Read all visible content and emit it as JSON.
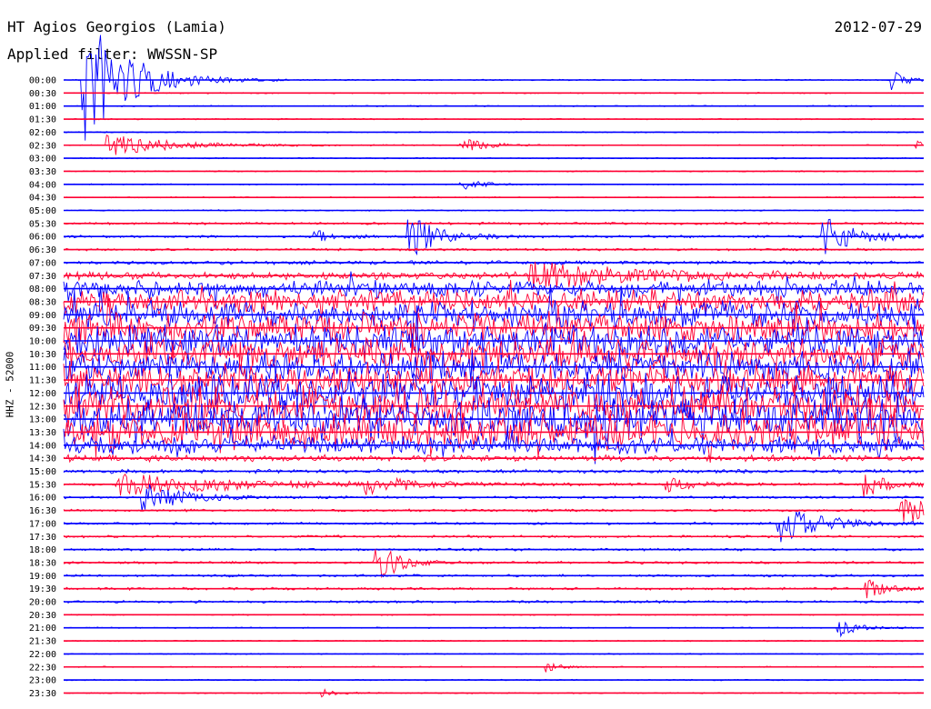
{
  "header": {
    "station": "HT Agios Georgios (Lamia)",
    "date": "2012-07-29",
    "filter": "Applied filter: WWSSN-SP",
    "channel": "HHZ - 52000"
  },
  "colors": {
    "even_rows": "#0000ff",
    "odd_rows": "#ff0033",
    "background": "#ffffff",
    "text": "#000000"
  },
  "chart_data": {
    "type": "line",
    "title": "HT Agios Georgios (Lamia)",
    "xlabel": "",
    "ylabel": "HHZ - 52000",
    "categories": [
      "00:00",
      "00:30",
      "01:00",
      "01:30",
      "02:00",
      "02:30",
      "03:00",
      "03:30",
      "04:00",
      "04:30",
      "05:00",
      "05:30",
      "06:00",
      "06:30",
      "07:00",
      "07:30",
      "08:00",
      "08:30",
      "09:00",
      "09:30",
      "10:00",
      "10:30",
      "11:00",
      "11:30",
      "12:00",
      "12:30",
      "13:00",
      "13:30",
      "14:00",
      "14:30",
      "15:00",
      "15:30",
      "16:00",
      "16:30",
      "17:00",
      "17:30",
      "18:00",
      "18:30",
      "19:00",
      "19:30",
      "20:00",
      "20:30",
      "21:00",
      "21:30",
      "22:00",
      "22:30",
      "23:00",
      "23:30"
    ],
    "noise": [
      1,
      1,
      1,
      1,
      1,
      1,
      1,
      1,
      1,
      1,
      1,
      2,
      2,
      2,
      3,
      6,
      14,
      18,
      22,
      24,
      26,
      24,
      24,
      26,
      30,
      32,
      34,
      30,
      14,
      5,
      3,
      2,
      2,
      2,
      2,
      2,
      2,
      2,
      2,
      2,
      2,
      1,
      1,
      1,
      1,
      1,
      1,
      1
    ],
    "events": [
      {
        "row": 0,
        "t": 0.02,
        "amp": 90,
        "dur": 0.06
      },
      {
        "row": 0,
        "t": 0.96,
        "amp": 14,
        "dur": 0.02
      },
      {
        "row": 5,
        "t": 0.05,
        "amp": 12,
        "dur": 0.1
      },
      {
        "row": 5,
        "t": 0.46,
        "amp": 8,
        "dur": 0.04
      },
      {
        "row": 5,
        "t": 0.99,
        "amp": 7,
        "dur": 0.01
      },
      {
        "row": 8,
        "t": 0.46,
        "amp": 7,
        "dur": 0.03
      },
      {
        "row": 12,
        "t": 0.4,
        "amp": 30,
        "dur": 0.04
      },
      {
        "row": 12,
        "t": 0.29,
        "amp": 7,
        "dur": 0.04
      },
      {
        "row": 12,
        "t": 0.88,
        "amp": 24,
        "dur": 0.05
      },
      {
        "row": 15,
        "t": 0.54,
        "amp": 14,
        "dur": 0.15
      },
      {
        "row": 31,
        "t": 0.06,
        "amp": 12,
        "dur": 0.2
      },
      {
        "row": 31,
        "t": 0.35,
        "amp": 10,
        "dur": 0.06
      },
      {
        "row": 31,
        "t": 0.7,
        "amp": 8,
        "dur": 0.04
      },
      {
        "row": 31,
        "t": 0.93,
        "amp": 14,
        "dur": 0.04
      },
      {
        "row": 32,
        "t": 0.09,
        "amp": 16,
        "dur": 0.06
      },
      {
        "row": 33,
        "t": 0.97,
        "amp": 22,
        "dur": 0.05
      },
      {
        "row": 34,
        "t": 0.83,
        "amp": 22,
        "dur": 0.06
      },
      {
        "row": 37,
        "t": 0.36,
        "amp": 28,
        "dur": 0.03
      },
      {
        "row": 39,
        "t": 0.93,
        "amp": 12,
        "dur": 0.03
      },
      {
        "row": 42,
        "t": 0.9,
        "amp": 10,
        "dur": 0.03
      },
      {
        "row": 45,
        "t": 0.56,
        "amp": 6,
        "dur": 0.02
      },
      {
        "row": 47,
        "t": 0.3,
        "amp": 8,
        "dur": 0.02
      }
    ]
  }
}
